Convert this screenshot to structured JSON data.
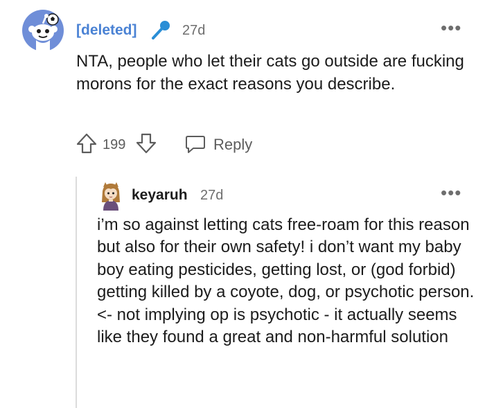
{
  "comment": {
    "author": "[deleted]",
    "time": "27d",
    "more_label": "•••",
    "body": "NTA, people who let their cats go outside are fucking morons for the exact reasons you describe.",
    "score": "199",
    "reply_label": "Reply",
    "author_color": "#4a82d4",
    "avatar_icon": "snoo-avatar-icon",
    "badge_icon": "microphone-icon"
  },
  "reply": {
    "author": "keyaruh",
    "time": "27d",
    "more_label": "•••",
    "body": "i’m so against letting cats free-roam for this reason but also for their own safety! i don’t want my baby boy eating pesticides, getting lost, or (god forbid) getting killed by a coyote, dog, or psychotic person. <- not implying op is psychotic - it actually seems like they found a great and non-harmful solution",
    "avatar_icon": "user-avatar-icon"
  }
}
